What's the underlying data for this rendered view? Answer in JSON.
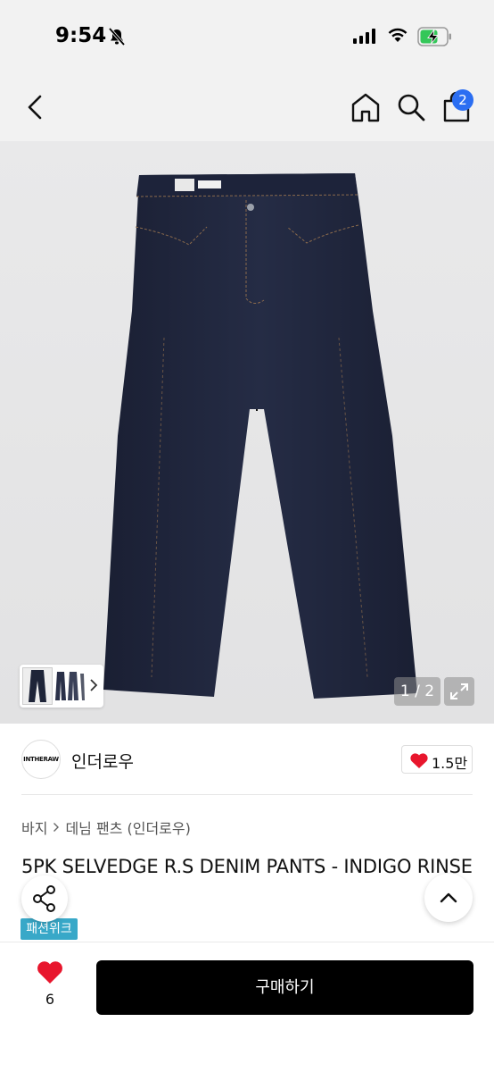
{
  "status_bar": {
    "time": "9:54"
  },
  "header": {
    "cart_count": "2"
  },
  "gallery": {
    "page_counter": "1 / 2"
  },
  "seller": {
    "logo_text": "INTHERAW",
    "name": "인더로우",
    "likes": "1.5만"
  },
  "breadcrumb": [
    "바지",
    "데님 팬츠 (인더로우)"
  ],
  "product": {
    "title": "5PK SELVEDGE R.S DENIM PANTS - INDIGO RINSE",
    "tag": "패션위크"
  },
  "bottom_bar": {
    "wish_count": "6",
    "buy_label": "구매하기"
  },
  "colors": {
    "accent_blue": "#2b6ef2",
    "heart_red": "#e8162d",
    "tag_teal": "#38a8c8",
    "denim": "#1e2438"
  }
}
